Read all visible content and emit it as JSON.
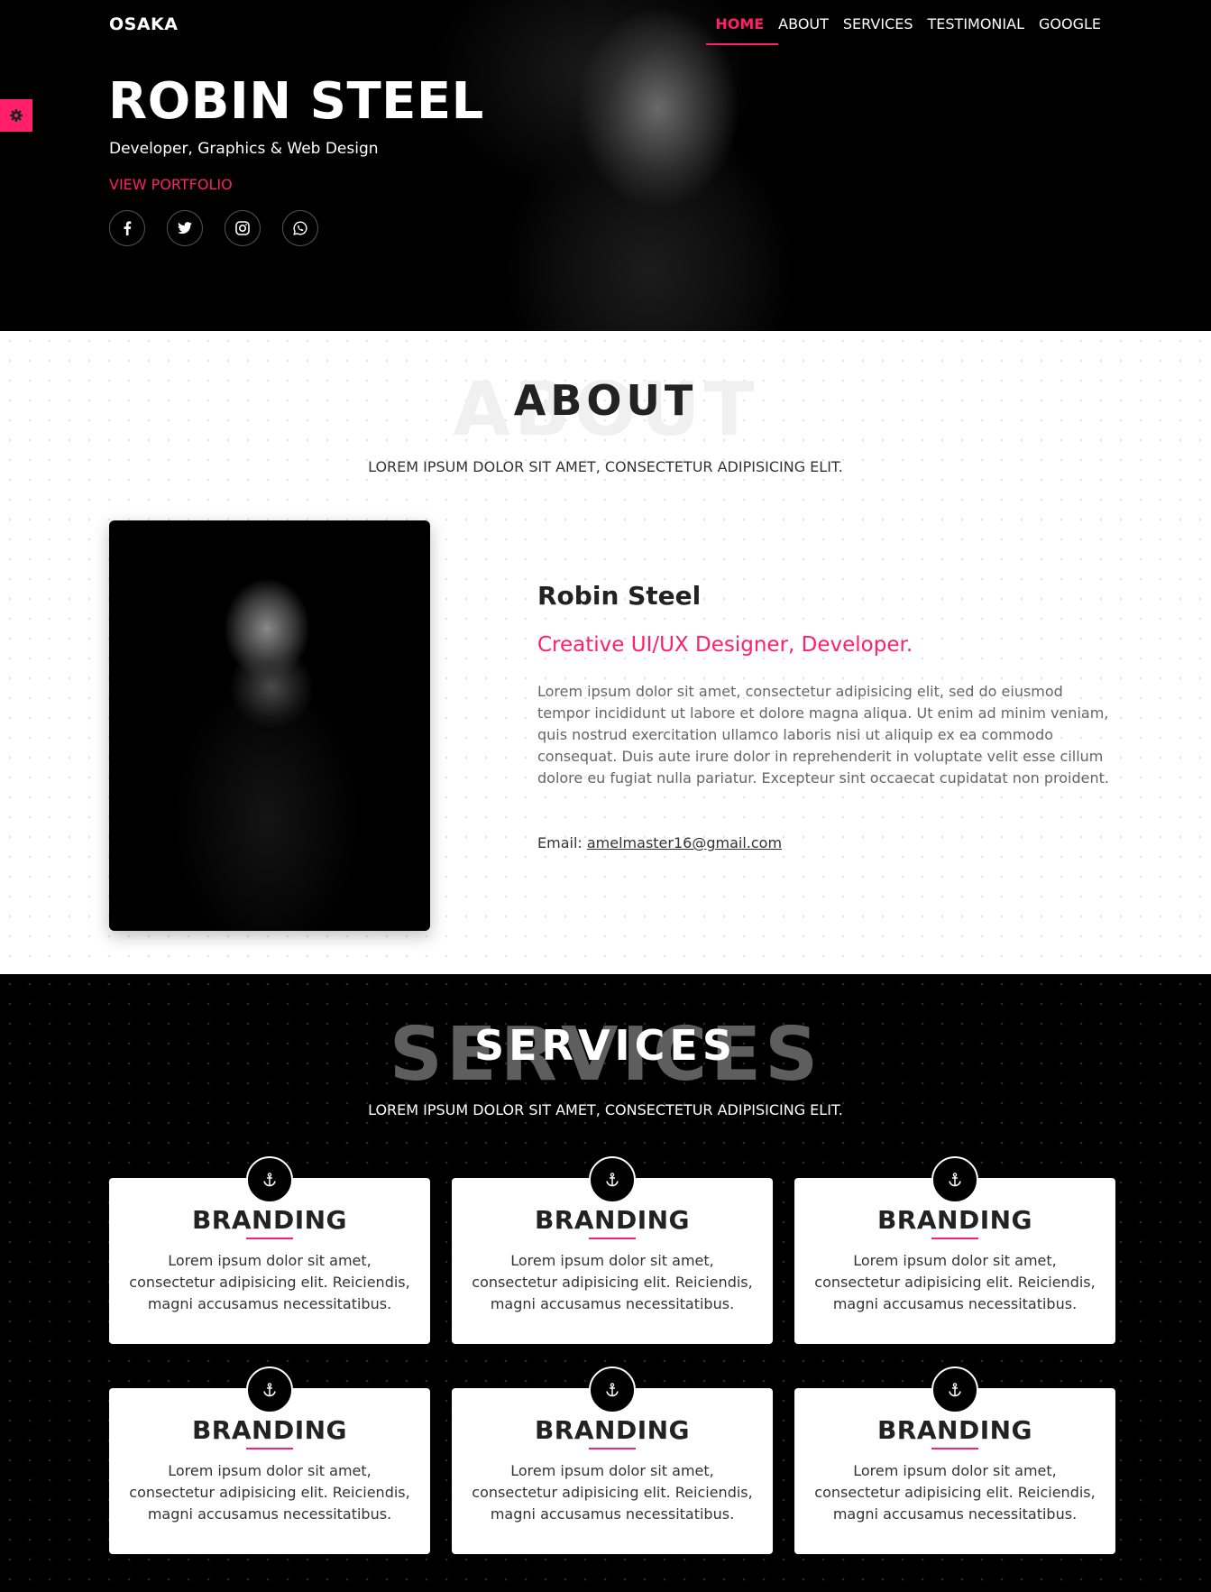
{
  "brand": "OSAKA",
  "nav": [
    {
      "label": "HOME",
      "active": true
    },
    {
      "label": "ABOUT",
      "active": false
    },
    {
      "label": "SERVICES",
      "active": false
    },
    {
      "label": "TESTIMONIAL",
      "active": false
    },
    {
      "label": "GOOGLE",
      "active": false
    }
  ],
  "hero": {
    "name": "ROBIN STEEL",
    "subtitle": "Developer, Graphics & Web Design",
    "cta": "VIEW PORTFOLIO",
    "socials": [
      "facebook-icon",
      "twitter-icon",
      "instagram-icon",
      "whatsapp-icon"
    ]
  },
  "about": {
    "title": "ABOUT",
    "background_word": "ABOUT",
    "subtitle": "LOREM IPSUM DOLOR SIT AMET, CONSECTETUR ADIPISICING ELIT.",
    "name": "Robin Steel",
    "role": "Creative UI/UX Designer, Developer.",
    "text": "Lorem ipsum dolor sit amet, consectetur adipisicing elit, sed do eiusmod tempor incididunt ut labore et dolore magna aliqua. Ut enim ad minim veniam, quis nostrud exercitation ullamco laboris nisi ut aliquip ex ea commodo consequat. Duis aute irure dolor in reprehenderit in voluptate velit esse cillum dolore eu fugiat nulla pariatur. Excepteur sint occaecat cupidatat non proident.",
    "email_label": "Email:",
    "email": "amelmaster16@gmail.com"
  },
  "services": {
    "title": "SERVICES",
    "background_word": "SERVICES",
    "subtitle": "LOREM IPSUM DOLOR SIT AMET, CONSECTETUR ADIPISICING ELIT.",
    "items": [
      {
        "icon": "anchor-icon",
        "title": "BRANDING",
        "text": "Lorem ipsum dolor sit amet, consectetur adipisicing elit. Reiciendis, magni accusamus necessitatibus."
      },
      {
        "icon": "anchor-icon",
        "title": "BRANDING",
        "text": "Lorem ipsum dolor sit amet, consectetur adipisicing elit. Reiciendis, magni accusamus necessitatibus."
      },
      {
        "icon": "anchor-icon",
        "title": "BRANDING",
        "text": "Lorem ipsum dolor sit amet, consectetur adipisicing elit. Reiciendis, magni accusamus necessitatibus."
      },
      {
        "icon": "anchor-icon",
        "title": "BRANDING",
        "text": "Lorem ipsum dolor sit amet, consectetur adipisicing elit. Reiciendis, magni accusamus necessitatibus."
      },
      {
        "icon": "anchor-icon",
        "title": "BRANDING",
        "text": "Lorem ipsum dolor sit amet, consectetur adipisicing elit. Reiciendis, magni accusamus necessitatibus."
      },
      {
        "icon": "anchor-icon",
        "title": "BRANDING",
        "text": "Lorem ipsum dolor sit amet, consectetur adipisicing elit. Reiciendis, magni accusamus necessitatibus."
      }
    ]
  },
  "colors": {
    "accent": "#ff1f6b",
    "dark": "#000000",
    "text": "#222222"
  }
}
